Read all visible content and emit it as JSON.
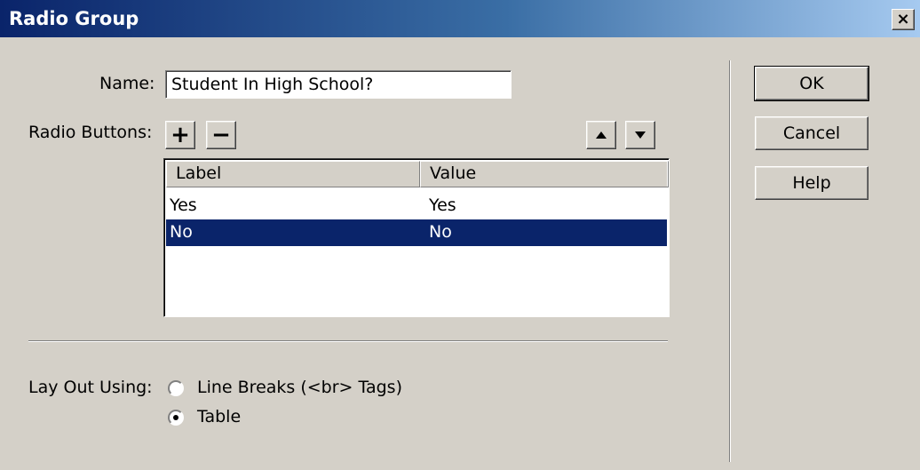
{
  "window": {
    "title": "Radio Group",
    "close_label": "×"
  },
  "name_field": {
    "label": "Name:",
    "value": "Student In High School?"
  },
  "radio_buttons": {
    "label": "Radio Buttons:",
    "add_label": "+",
    "remove_label": "−",
    "columns": [
      "Label",
      "Value"
    ],
    "rows": [
      {
        "label": "Yes",
        "value": "Yes",
        "selected": false
      },
      {
        "label": "No",
        "value": "No",
        "selected": true
      }
    ]
  },
  "layout": {
    "label": "Lay Out Using:",
    "options": [
      {
        "label": "Line Breaks (<br> Tags)",
        "selected": false
      },
      {
        "label": "Table",
        "selected": true
      }
    ]
  },
  "buttons": {
    "ok": "OK",
    "cancel": "Cancel",
    "help": "Help"
  },
  "colors": {
    "title_bar": "#0a246a",
    "selection": "#0a246a",
    "face": "#d4d0c8"
  },
  "icons": {
    "move_up": "triangle-up-icon",
    "move_down": "triangle-down-icon"
  }
}
